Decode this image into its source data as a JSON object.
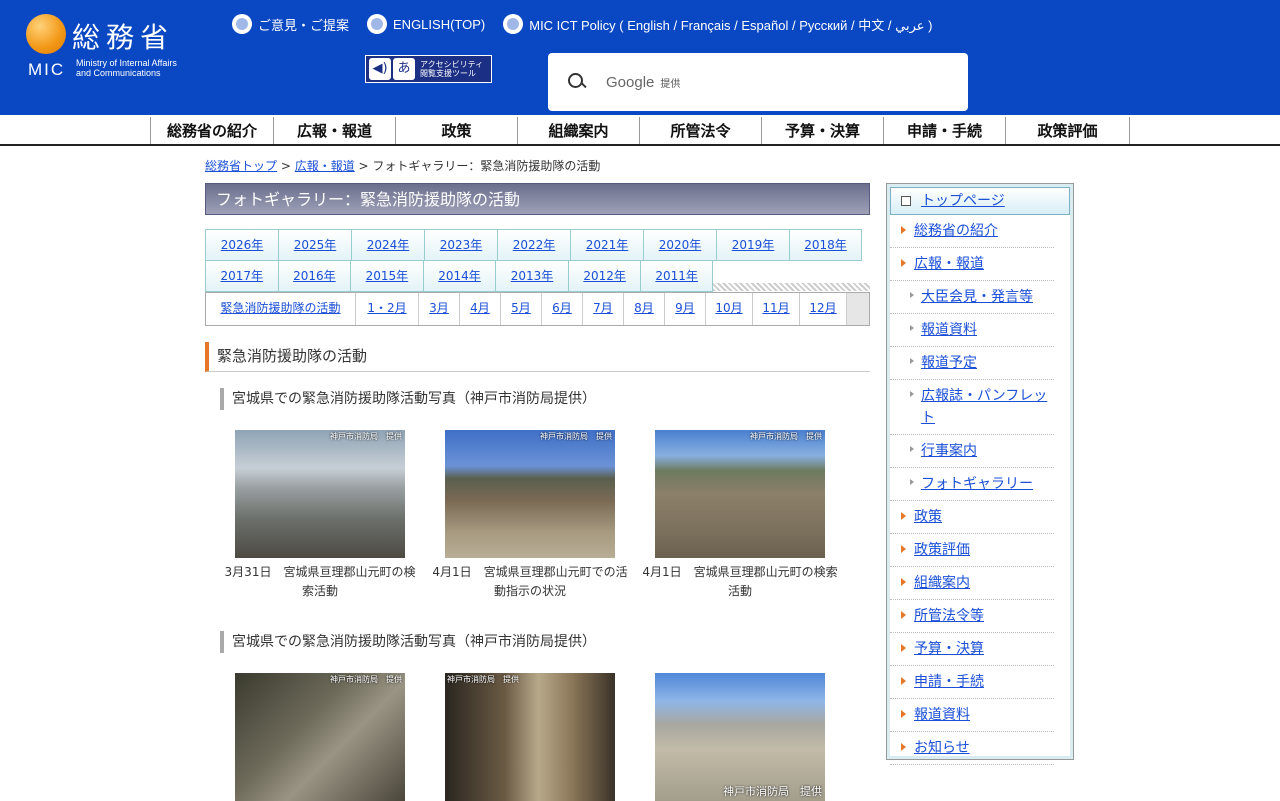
{
  "header": {
    "logo_kanji": "総務省",
    "logo_mic": "MIC",
    "logo_en_line1": "Ministry of Internal Affairs",
    "logo_en_line2": "and Communications",
    "top_links": [
      "ご意見・ご提案",
      "ENGLISH(TOP)",
      "MIC ICT Policy ( English / Français / Español / Русский / 中文 / عربي )"
    ],
    "a11y_line1": "アクセシビリティ",
    "a11y_line2": "閲覧支援ツール",
    "search_brand": "Google",
    "search_sub": "提供"
  },
  "gnav": [
    "総務省の紹介",
    "広報・報道",
    "政策",
    "組織案内",
    "所管法令",
    "予算・決算",
    "申請・手続",
    "政策評価"
  ],
  "breadcrumb": {
    "home": "総務省トップ",
    "sep": " > ",
    "parent": "広報・報道",
    "current": "フォトギャラリー：緊急消防援助隊の活動"
  },
  "page_title": "フォトギャラリー：緊急消防援助隊の活動",
  "years_row1": [
    "2026年",
    "2025年",
    "2024年",
    "2023年",
    "2022年",
    "2021年",
    "2020年",
    "2019年",
    "2018年"
  ],
  "years_row2": [
    "2017年",
    "2016年",
    "2015年",
    "2014年",
    "2013年",
    "2012年",
    "2011年"
  ],
  "months": [
    "緊急消防援助隊の活動",
    "1・2月",
    "3月",
    "4月",
    "5月",
    "6月",
    "7月",
    "8月",
    "9月",
    "10月",
    "11月",
    "12月"
  ],
  "section_heading": "緊急消防援助隊の活動",
  "subheads": [
    "宮城県での緊急消防援助隊活動写真（神戸市消防局提供）",
    "宮城県での緊急消防援助隊活動写真（神戸市消防局提供）"
  ],
  "photo_credit": "神戸市消防局　提供",
  "photos_row1": [
    {
      "caption": "3月31日　宮城県亘理郡山元町の検索活動"
    },
    {
      "caption": "4月1日　宮城県亘理郡山元町での活動指示の状況"
    },
    {
      "caption": "4月1日　宮城県亘理郡山元町の検索活動"
    }
  ],
  "sidenav": {
    "top": "トップページ",
    "items": [
      {
        "label": "総務省の紹介",
        "level": 1
      },
      {
        "label": "広報・報道",
        "level": 1
      },
      {
        "label": "大臣会見・発言等",
        "level": 2
      },
      {
        "label": "報道資料",
        "level": 2
      },
      {
        "label": "報道予定",
        "level": 2
      },
      {
        "label": "広報誌・パンフレット",
        "level": 2
      },
      {
        "label": "行事案内",
        "level": 2
      },
      {
        "label": "フォトギャラリー",
        "level": 2
      },
      {
        "label": "政策",
        "level": 1
      },
      {
        "label": "政策評価",
        "level": 1
      },
      {
        "label": "組織案内",
        "level": 1
      },
      {
        "label": "所管法令等",
        "level": 1
      },
      {
        "label": "予算・決算",
        "level": 1
      },
      {
        "label": "申請・手続",
        "level": 1
      },
      {
        "label": "報道資料",
        "level": 1
      },
      {
        "label": "お知らせ",
        "level": 1
      }
    ]
  },
  "colors": {
    "header_bg": "#0a48c3",
    "accent_orange": "#e6782a",
    "link": "#1a4fd6"
  }
}
